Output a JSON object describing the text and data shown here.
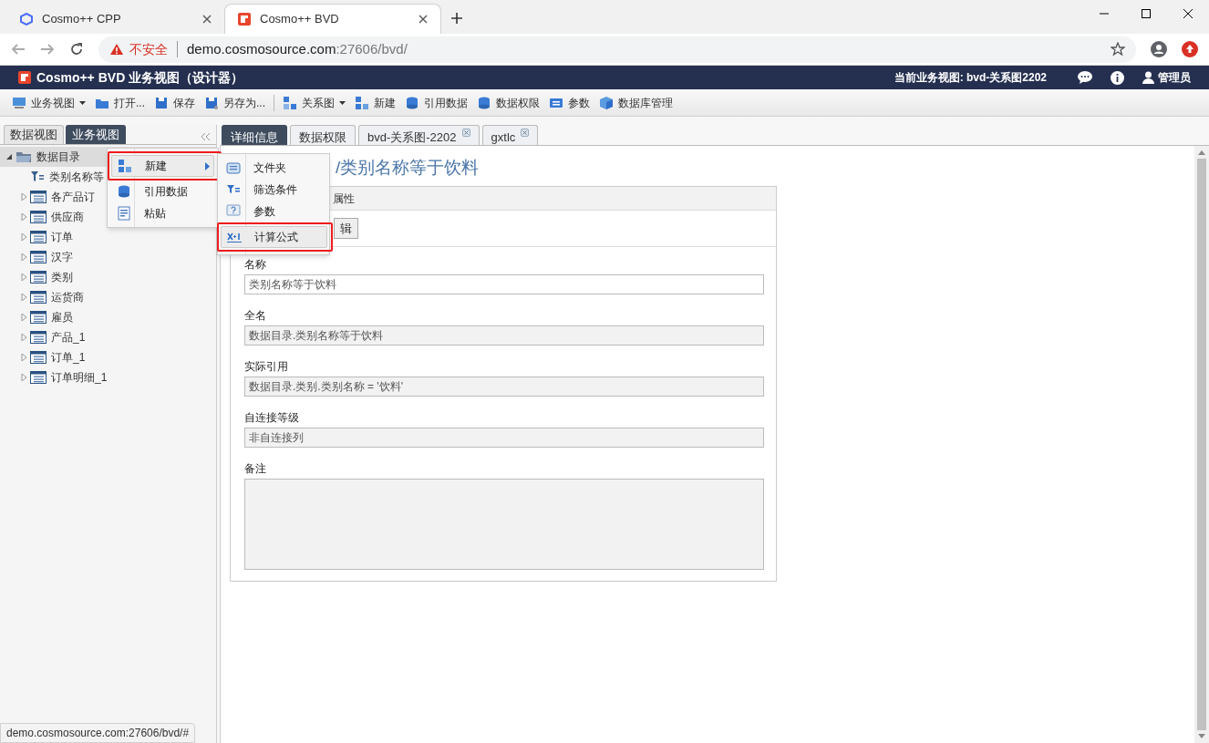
{
  "browser": {
    "tabs": [
      {
        "title": "Cosmo++ CPP",
        "selected": false,
        "kind": "cpp"
      },
      {
        "title": "Cosmo++ BVD",
        "selected": true,
        "kind": "bvd"
      }
    ],
    "address": {
      "warning": "不安全",
      "host": "demo.cosmosource.com",
      "path": ":27606/bvd/"
    }
  },
  "app": {
    "title": "Cosmo++ BVD 业务视图（设计器）",
    "current_view": "当前业务视图: bvd-关系图2202",
    "user": "管理员"
  },
  "toolbar": [
    {
      "label": "业务视图",
      "dropdown": true,
      "separator_before": false
    },
    {
      "label": "打开...",
      "dropdown": false,
      "separator_before": false
    },
    {
      "label": "保存",
      "dropdown": false,
      "separator_before": false
    },
    {
      "label": "另存为...",
      "dropdown": false,
      "separator_before": false
    },
    {
      "label": "关系图",
      "dropdown": true,
      "separator_before": true
    },
    {
      "label": "新建",
      "dropdown": false,
      "separator_before": false
    },
    {
      "label": "引用数据",
      "dropdown": false,
      "separator_before": false
    },
    {
      "label": "数据权限",
      "dropdown": false,
      "separator_before": false
    },
    {
      "label": "参数",
      "dropdown": false,
      "separator_before": false
    },
    {
      "label": "数据库管理",
      "dropdown": false,
      "separator_before": false
    }
  ],
  "left_tabs": [
    {
      "label": "数据视图",
      "selected": false
    },
    {
      "label": "业务视图",
      "selected": true
    }
  ],
  "tree": [
    {
      "label": "数据目录",
      "kind": "folder",
      "expanded": true,
      "selected": true,
      "children": [
        {
          "label": "类别名称等",
          "kind": "filter",
          "selected": false
        },
        {
          "label": "各产品订",
          "kind": "table",
          "expanded": false,
          "selected": false
        },
        {
          "label": "供应商",
          "kind": "table",
          "expanded": false,
          "selected": false
        },
        {
          "label": "订单",
          "kind": "table",
          "expanded": false,
          "selected": false
        },
        {
          "label": "汉字",
          "kind": "table",
          "expanded": false,
          "selected": false
        },
        {
          "label": "类别",
          "kind": "table",
          "expanded": false,
          "selected": false
        },
        {
          "label": "运货商",
          "kind": "table",
          "expanded": false,
          "selected": false
        },
        {
          "label": "雇员",
          "kind": "table",
          "expanded": false,
          "selected": false
        },
        {
          "label": "产品_1",
          "kind": "table",
          "expanded": false,
          "selected": false
        },
        {
          "label": "订单_1",
          "kind": "table",
          "expanded": false,
          "selected": false
        },
        {
          "label": "订单明细_1",
          "kind": "table",
          "expanded": false,
          "selected": false
        }
      ]
    }
  ],
  "right_tabs": [
    {
      "label": "详细信息",
      "selected": true,
      "closable": false
    },
    {
      "label": "数据权限",
      "selected": false,
      "closable": false
    },
    {
      "label": "bvd-关系图-2202",
      "selected": false,
      "closable": true
    },
    {
      "label": "gxtlc",
      "selected": false,
      "closable": true
    }
  ],
  "detail": {
    "title": "/类别名称等于饮料",
    "section": "属性",
    "button": "辑",
    "fields": [
      {
        "label": "名称",
        "value": "类别名称等于饮料",
        "readonly": false,
        "kind": "input"
      },
      {
        "label": "全名",
        "value": "数据目录.类别名称等于饮料",
        "readonly": true,
        "kind": "input"
      },
      {
        "label": "实际引用",
        "value": "数据目录.类别.类别名称 = '饮料'",
        "readonly": true,
        "kind": "input"
      },
      {
        "label": "自连接等级",
        "value": "非自连接列",
        "readonly": true,
        "kind": "input"
      },
      {
        "label": "备注",
        "readonly": true,
        "kind": "textarea"
      }
    ]
  },
  "context_menu": [
    {
      "label": "新建",
      "submenu": true,
      "highlighted": true
    },
    {
      "label": "引用数据",
      "submenu": false,
      "highlighted": false
    },
    {
      "label": "粘贴",
      "submenu": false,
      "highlighted": false
    }
  ],
  "submenu": [
    {
      "label": "文件夹",
      "highlighted": false
    },
    {
      "label": "筛选条件",
      "highlighted": false
    },
    {
      "label": "参数",
      "highlighted": false
    },
    {
      "label": "计算公式",
      "highlighted": true
    }
  ],
  "status_url": "demo.cosmosource.com:27606/bvd/#"
}
